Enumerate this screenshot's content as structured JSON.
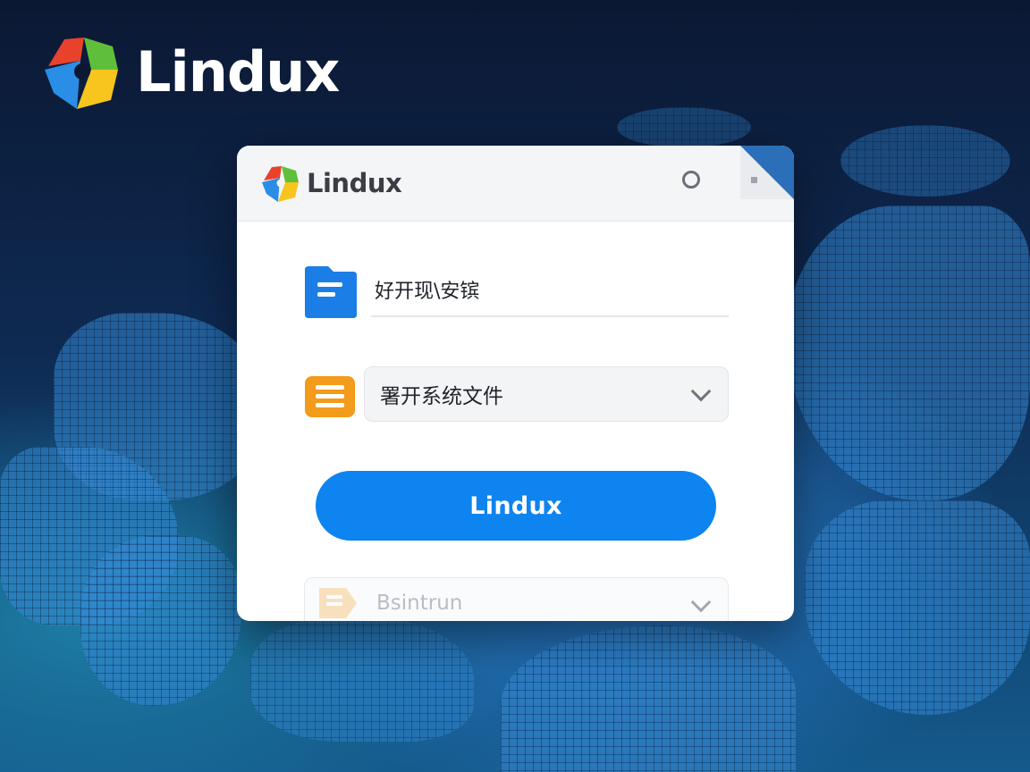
{
  "brand": {
    "name": "Lindux",
    "logo_icon": "pinwheel-logo-icon"
  },
  "dialog": {
    "title": "Lindux",
    "logo_icon": "pinwheel-logo-icon",
    "header_icon": "settings-ring-icon",
    "fields": [
      {
        "icon": "folder-icon",
        "value": "好开现\\安镔"
      },
      {
        "icon": "document-icon",
        "value": "署开系统文件",
        "control": "dropdown"
      },
      {
        "icon": "document-icon",
        "value": "Bsintrun",
        "control": "dropdown"
      }
    ],
    "primary_button": "Lindux"
  },
  "colors": {
    "accent": "#0d84f0",
    "folder": "#1a7ee6",
    "document": "#f39b1a",
    "logo_red": "#e8412c",
    "logo_green": "#5fbf3a",
    "logo_yellow": "#f7c51e",
    "logo_blue": "#2a8de6"
  }
}
